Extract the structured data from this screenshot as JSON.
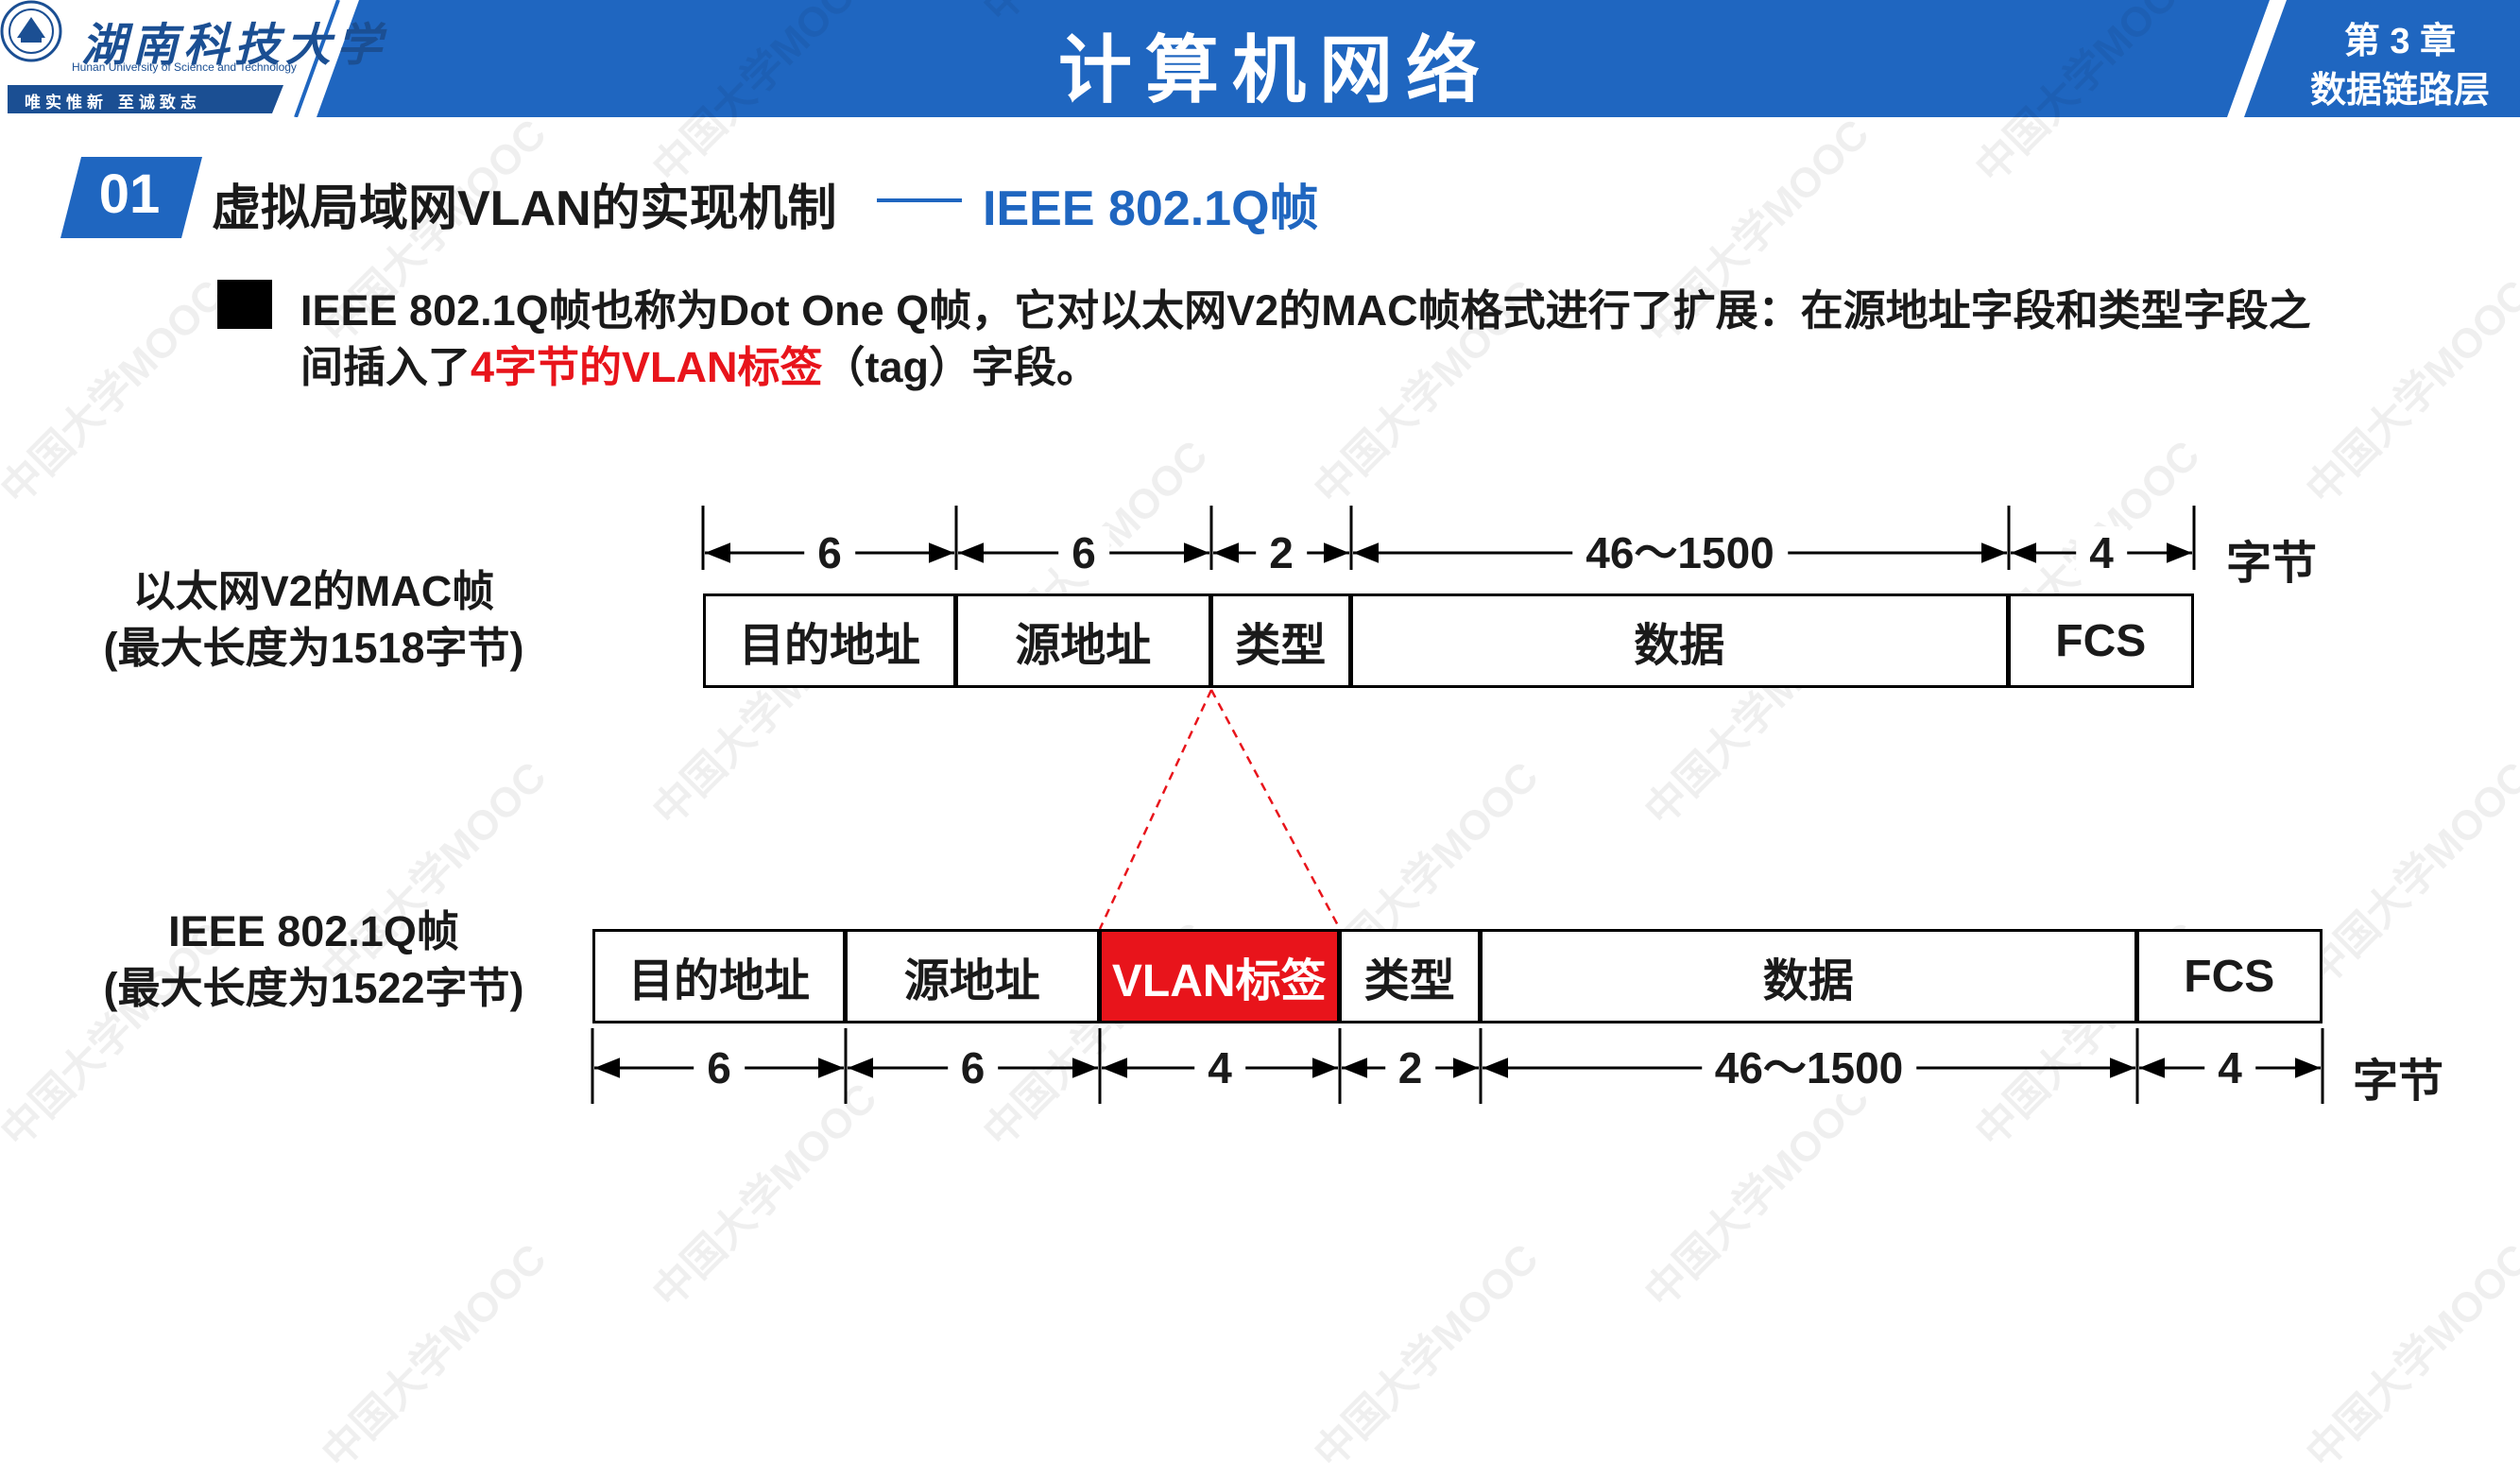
{
  "header": {
    "university_name": "湖南科技大学",
    "university_en": "Hunan University of Science and Technology",
    "motto": "唯实惟新 至诚致志",
    "course_title": "计算机网络",
    "chapter_number": "第 3 章",
    "chapter_name": "数据链路层",
    "colors": {
      "bar": "#1f66c0",
      "accent": "#1b4f93"
    }
  },
  "section": {
    "number": "01",
    "title": "虚拟局域网VLAN的实现机制",
    "subtitle": "IEEE 802.1Q帧"
  },
  "bullet": {
    "line1": "IEEE 802.1Q帧也称为Dot One Q帧，它对以太网V2的MAC帧格式进行了扩展：在源地址字段和类型字段之",
    "line2_before": "间插入了",
    "line2_highlight": "4字节的VLAN标签",
    "line2_after": "（tag）字段。"
  },
  "frame_v2": {
    "label_line1": "以太网V2的MAC帧",
    "label_line2": "(最大长度为1518字节)",
    "fields": [
      "目的地址",
      "源地址",
      "类型",
      "数据",
      "FCS"
    ],
    "sizes": [
      "6",
      "6",
      "2",
      "46～1500",
      "4"
    ],
    "unit": "字节"
  },
  "frame_q": {
    "label_line1": "IEEE 802.1Q帧",
    "label_line2": "(最大长度为1522字节)",
    "fields": [
      "目的地址",
      "源地址",
      "VLAN标签",
      "类型",
      "数据",
      "FCS"
    ],
    "sizes": [
      "6",
      "6",
      "4",
      "2",
      "46～1500",
      "4"
    ],
    "unit": "字节",
    "highlight_color": "#e8141b"
  },
  "watermark": "中国大学MOOC"
}
